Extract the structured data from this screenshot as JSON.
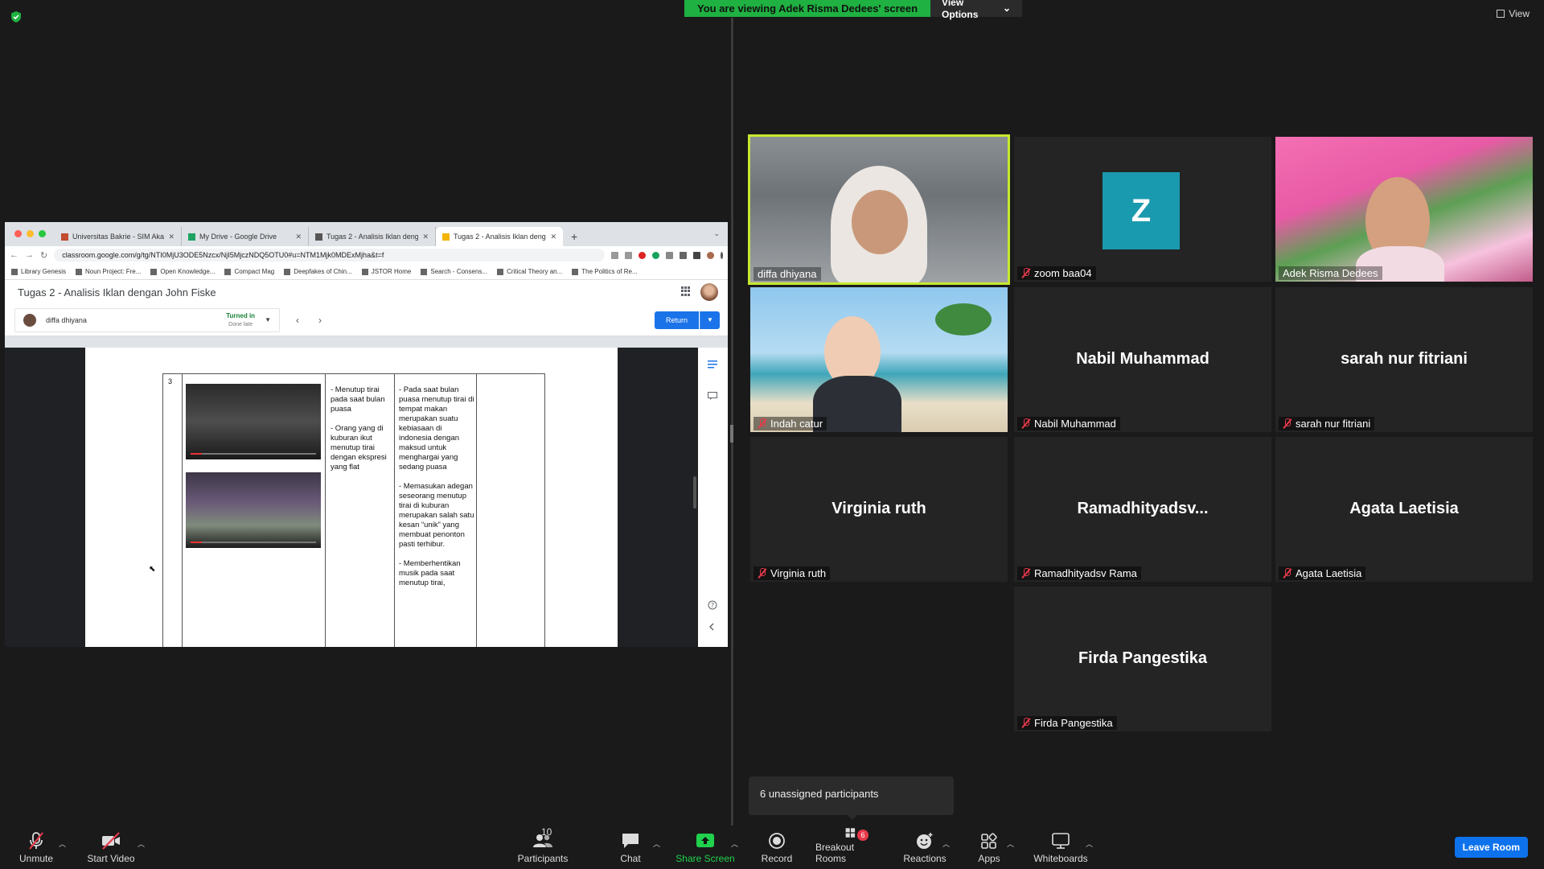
{
  "banner": {
    "viewing_text": "You are viewing Adek Risma Dedees' screen",
    "view_options": "View Options",
    "view_label": "View"
  },
  "browser": {
    "tabs": [
      {
        "title": "Universitas Bakrie - SIM Akad..."
      },
      {
        "title": "My Drive - Google Drive"
      },
      {
        "title": "Tugas 2 - Analisis Iklan denga..."
      },
      {
        "title": "Tugas 2 - Analisis Iklan denga..."
      }
    ],
    "url": "classroom.google.com/g/tg/NTI0MjU3ODE5Nzcx/NjI5MjczNDQ5OTU0#u=NTM1Mjk0MDExMjha&t=f",
    "bookmarks": [
      "Library Genesis",
      "Noun Project: Fre...",
      "Open Knowledge...",
      "Compact Mag",
      "Deepfakes of Chin...",
      "JSTOR Home",
      "Search - Consens...",
      "Critical Theory an...",
      "The Politics of Re..."
    ],
    "page_title": "Tugas 2 - Analisis Iklan dengan John Fiske",
    "student_name": "diffa dhiyana",
    "status": "Turned in",
    "status_sub": "Done late",
    "return_label": "Return",
    "row_number": "3",
    "col1_text": "- Menutup tirai pada saat bulan puasa\n\n- Orang yang di kuburan ikut menutup tirai dengan ekspresi yang flat",
    "col2_text": "- Pada saat bulan puasa menutup tirai di tempat makan merupakan suatu kebiasaan di indonesia dengan maksud untuk menghargai yang sedang puasa\n\n- Memasukan adegan seseorang menutup tirai di kuburan merupakan salah satu kesan “unik” yang membuat penonton pasti terhibur.\n\n- Memberhentikan musik pada saat menutup tirai,"
  },
  "participants": [
    {
      "name": "diffa dhiyana",
      "display": ""
    },
    {
      "name": "zoom baa04",
      "display": "Z"
    },
    {
      "name": "Adek Risma Dedees",
      "display": ""
    },
    {
      "name": "Indah catur",
      "display": ""
    },
    {
      "name": "Nabil Muhammad",
      "display": "Nabil Muhammad"
    },
    {
      "name": "sarah nur fitriani",
      "display": "sarah nur fitriani"
    },
    {
      "name": "Virginia ruth",
      "display": "Virginia ruth"
    },
    {
      "name": "Ramadhityadsv Rama",
      "display": "Ramadhityadsv..."
    },
    {
      "name": "Agata Laetisia",
      "display": "Agata Laetisia"
    },
    {
      "name": "Firda Pangestika",
      "display": "Firda Pangestika"
    }
  ],
  "unassigned_text": "6 unassigned participants",
  "toolbar": {
    "unmute": "Unmute",
    "start_video": "Start Video",
    "participants": "Participants",
    "participants_count": "10",
    "chat": "Chat",
    "share_screen": "Share Screen",
    "record": "Record",
    "breakout_rooms": "Breakout Rooms",
    "breakout_badge": "6",
    "reactions": "Reactions",
    "apps": "Apps",
    "whiteboards": "Whiteboards",
    "leave_room": "Leave Room"
  },
  "colors": {
    "banner_green": "#1fb141",
    "active_speaker": "#c6e830",
    "leave_blue": "#0e72ed",
    "mic_off_red": "#e8394a"
  }
}
